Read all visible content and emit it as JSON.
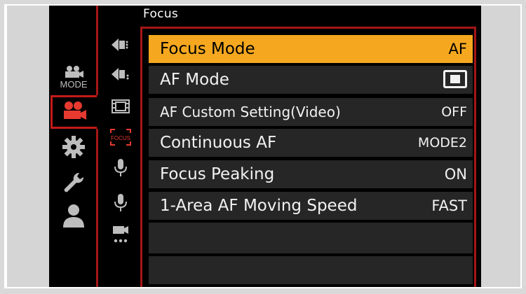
{
  "menu": {
    "tab_title": "Focus",
    "categories": [
      {
        "name": "MODE",
        "icon": "mode-camera-icon",
        "selected": false
      },
      {
        "name": "",
        "icon": "video-camera-icon",
        "selected": true
      },
      {
        "name": "",
        "icon": "gear-icon",
        "selected": false
      },
      {
        "name": "",
        "icon": "wrench-icon",
        "selected": false
      },
      {
        "name": "",
        "icon": "person-icon",
        "selected": false
      }
    ],
    "subtabs": [
      {
        "icon": "video-format-icon"
      },
      {
        "icon": "video-quality-icon"
      },
      {
        "icon": "film-frame-icon"
      },
      {
        "icon": "focus-icon",
        "label": "FOCUS",
        "selected": true
      },
      {
        "icon": "audio-mic-icon"
      },
      {
        "icon": "audio-mic-2-icon"
      },
      {
        "icon": "video-other-icon"
      }
    ],
    "items": [
      {
        "label": "Focus Mode",
        "value": "AF",
        "selected": true
      },
      {
        "label": "AF Mode",
        "value": "",
        "value_icon": "af-area-icon"
      },
      {
        "label": "AF Custom Setting(Video)",
        "value": "OFF"
      },
      {
        "label": "Continuous AF",
        "value": "MODE2"
      },
      {
        "label": "Focus Peaking",
        "value": "ON"
      },
      {
        "label": "1-Area AF Moving Speed",
        "value": "FAST"
      }
    ]
  },
  "colors": {
    "accent": "#f5a81f",
    "frame_red": "#a51616",
    "row_bg": "#262626",
    "text": "#f2f2f2"
  }
}
